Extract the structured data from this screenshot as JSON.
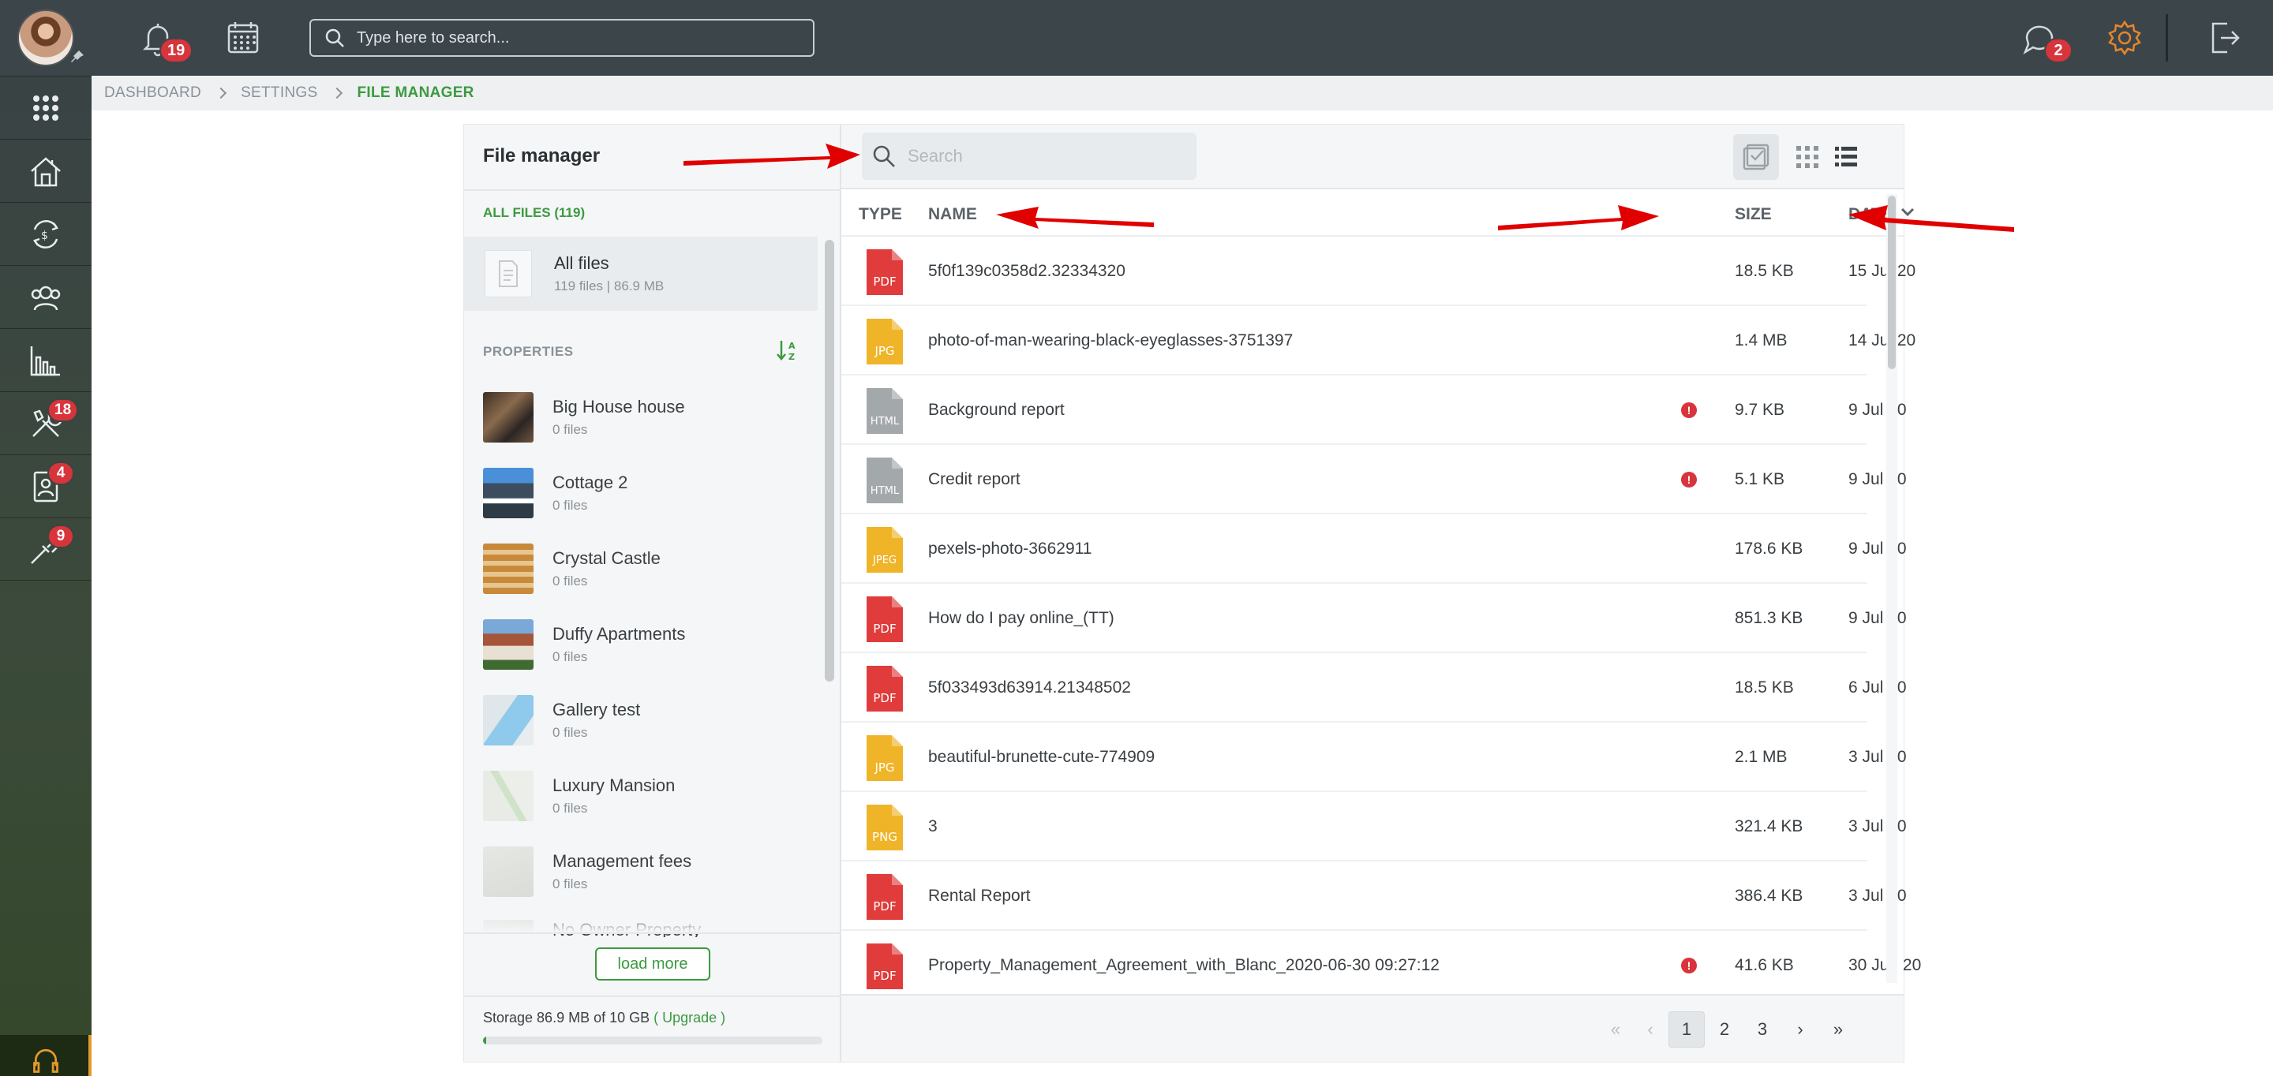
{
  "header": {
    "notifications_count": "19",
    "search_placeholder": "Type here to search...",
    "messages_count": "2"
  },
  "sidebar": {
    "items": [
      {
        "icon": "apps-grid-icon",
        "badge": ""
      },
      {
        "icon": "house-icon",
        "badge": ""
      },
      {
        "icon": "money-cycle-icon",
        "badge": ""
      },
      {
        "icon": "users-icon",
        "badge": ""
      },
      {
        "icon": "bar-chart-icon",
        "badge": ""
      },
      {
        "icon": "tools-icon",
        "badge": "18"
      },
      {
        "icon": "contact-card-icon",
        "badge": "4"
      },
      {
        "icon": "pipette-icon",
        "badge": "9"
      }
    ]
  },
  "breadcrumb": {
    "items": [
      "DASHBOARD",
      "SETTINGS",
      "FILE MANAGER"
    ]
  },
  "file_manager": {
    "title": "File manager",
    "all_files_label": "ALL FILES (119)",
    "all_files": {
      "name": "All files",
      "meta": "119 files | 86.9 MB"
    },
    "properties_label": "PROPERTIES",
    "properties": [
      {
        "name": "Big House house",
        "count": "0 files"
      },
      {
        "name": "Cottage 2",
        "count": "0 files"
      },
      {
        "name": "Crystal Castle",
        "count": "0 files"
      },
      {
        "name": "Duffy Apartments",
        "count": "0 files"
      },
      {
        "name": "Gallery test",
        "count": "0 files"
      },
      {
        "name": "Luxury Mansion",
        "count": "0 files"
      },
      {
        "name": "Management fees",
        "count": "0 files"
      },
      {
        "name": "No Owner Property",
        "count": ""
      }
    ],
    "load_more_label": "load more",
    "storage_text": "Storage 86.9 MB of 10 GB",
    "upgrade_label": "( Upgrade )",
    "storage_used_fraction": 0.0087,
    "search_placeholder": "Search",
    "columns": {
      "type": "TYPE",
      "name": "NAME",
      "size": "SIZE",
      "date": "DATE"
    },
    "files": [
      {
        "type": "PDF",
        "name": "5f0f139c0358d2.32334320",
        "alert": false,
        "size": "18.5 KB",
        "date": "15 Jul 20"
      },
      {
        "type": "JPG",
        "name": "photo-of-man-wearing-black-eyeglasses-3751397",
        "alert": false,
        "size": "1.4 MB",
        "date": "14 Jul 20"
      },
      {
        "type": "HTML",
        "name": "Background report",
        "alert": true,
        "size": "9.7 KB",
        "date": "9 Jul 20"
      },
      {
        "type": "HTML",
        "name": "Credit report",
        "alert": true,
        "size": "5.1 KB",
        "date": "9 Jul 20"
      },
      {
        "type": "JPEG",
        "name": "pexels-photo-3662911",
        "alert": false,
        "size": "178.6 KB",
        "date": "9 Jul 20"
      },
      {
        "type": "PDF",
        "name": "How do I pay online_(TT)",
        "alert": false,
        "size": "851.3 KB",
        "date": "9 Jul 20"
      },
      {
        "type": "PDF",
        "name": "5f033493d63914.21348502",
        "alert": false,
        "size": "18.5 KB",
        "date": "6 Jul 20"
      },
      {
        "type": "JPG",
        "name": "beautiful-brunette-cute-774909",
        "alert": false,
        "size": "2.1 MB",
        "date": "3 Jul 20"
      },
      {
        "type": "PNG",
        "name": "3",
        "alert": false,
        "size": "321.4 KB",
        "date": "3 Jul 20"
      },
      {
        "type": "PDF",
        "name": "Rental Report",
        "alert": false,
        "size": "386.4 KB",
        "date": "3 Jul 20"
      },
      {
        "type": "PDF",
        "name": "Property_Management_Agreement_with_Blanc_2020-06-30 09:27:12",
        "alert": true,
        "size": "41.6 KB",
        "date": "30 Jun 20"
      }
    ],
    "pagination": {
      "pages": [
        "1",
        "2",
        "3"
      ],
      "current": "1"
    }
  },
  "colors": {
    "accent_green": "#3c9a3f",
    "badge_red": "#d8343b",
    "header_bg": "#3c454a",
    "pdf_red": "#e03c3c",
    "image_yellow": "#f0b429",
    "html_gray": "#a3a8ab",
    "settings_orange": "#e4862b",
    "annotation_red": "#e00000"
  }
}
